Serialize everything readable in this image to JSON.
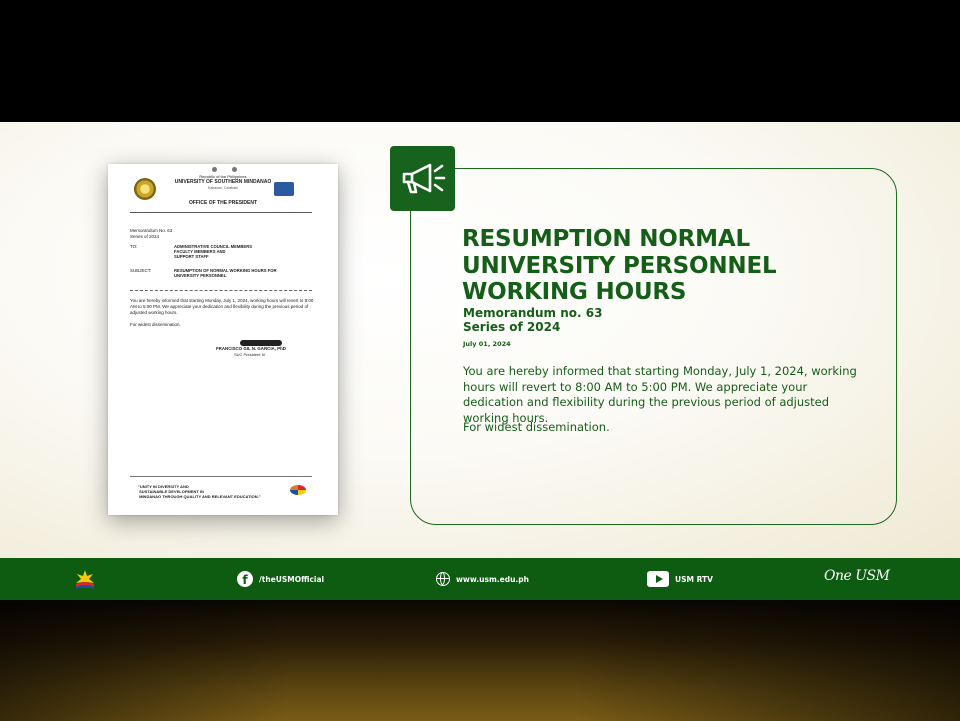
{
  "memo_paper": {
    "republic": "Republic of the Philippines",
    "university": "UNIVERSITY OF SOUTHERN MINDANAO",
    "location": "Kabacan, Cotabato",
    "office": "OFFICE OF THE PRESIDENT",
    "memo_number": "Memorandum No. 63",
    "memo_series": "Series of 2024",
    "to_label": "TO:",
    "to_value": "ADMINISTRATIVE COUNCIL MEMBERS\nFACULTY MEMBERS AND\nSUPPORT STAFF",
    "subject_label": "SUBJECT:",
    "subject_value": "RESUMPTION OF NORMAL WORKING HOURS FOR\nUNIVERSITY PERSONNEL",
    "body": "You are hereby informed that starting Monday, July 1, 2024, working hours will revert to 8:00 AM to 5:00 PM. We appreciate your dedication and flexibility during the previous period of adjusted working hours.",
    "dissemination": "For widest dissemination.",
    "signatory_name": "FRANCISCO GIL N. GARCIA, PhD",
    "signatory_role": "SUC President IV",
    "footer_tagline": "\"UNITY IN DIVERSITY AND\n SUSTAINABLE DEVELOPMENT IN\n MINDANAO THROUGH QUALITY AND RELEVANT EDUCATION.\""
  },
  "announcement": {
    "icon": "megaphone-icon",
    "title_lines": [
      "RESUMPTION NORMAL",
      "UNIVERSITY PERSONNEL",
      "WORKING HOURS"
    ],
    "memo_no": "Memorandum no. 63",
    "series": "Series of 2024",
    "date": "July 01, 2024",
    "message": "You are hereby informed that starting Monday, July 1, 2024, working hours will revert to 8:00 AM to 5:00 PM. We appreciate your dedication and flexibility during the previous period of adjusted working hours.",
    "dissemination": "For widest dissemination."
  },
  "footer": {
    "facebook": "/theUSMOfficial",
    "website": "www.usm.edu.ph",
    "youtube": "USM RTV",
    "slogan": "One USM"
  },
  "colors": {
    "brand_green": "#155e18",
    "footer_green": "#0e5c12"
  }
}
